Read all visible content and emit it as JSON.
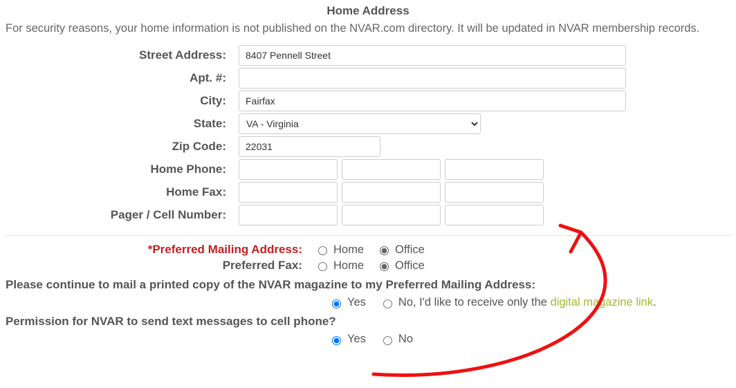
{
  "section": {
    "title": "Home Address"
  },
  "note": "For security reasons, your home information is not published on the NVAR.com directory. It will be updated in NVAR membership records.",
  "labels": {
    "street": "Street Address:",
    "apt": "Apt. #:",
    "city": "City:",
    "state": "State:",
    "zip": "Zip Code:",
    "home_phone": "Home Phone:",
    "home_fax": "Home Fax:",
    "pager": "Pager / Cell Number:",
    "pref_mailing": "*Preferred Mailing Address:",
    "pref_fax": "Preferred Fax:"
  },
  "values": {
    "street": "8407 Pennell Street",
    "apt": "",
    "city": "Fairfax",
    "state": "VA - Virginia",
    "zip": "22031"
  },
  "pref_options": {
    "home": "Home",
    "office": "Office"
  },
  "magazine": {
    "question": "Please continue to mail a printed copy of the NVAR magazine to my Preferred Mailing Address:",
    "yes": "Yes",
    "no_prefix": "No, I'd like to receive only the ",
    "link": "digital magazine link",
    "no_suffix": "."
  },
  "sms": {
    "question": "Permission for NVAR to send text messages to cell phone?",
    "yes": "Yes",
    "no": "No"
  }
}
